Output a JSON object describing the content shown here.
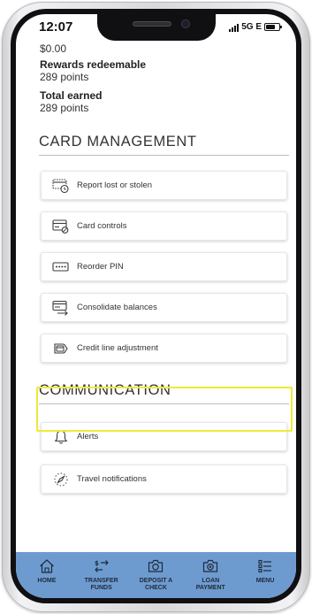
{
  "status_bar": {
    "time": "12:07",
    "network": "5G E"
  },
  "summary": {
    "balance": "$0.00",
    "rewards_label": "Rewards redeemable",
    "rewards_value": "289 points",
    "earned_label": "Total earned",
    "earned_value": "289 points"
  },
  "card_management": {
    "title": "CARD MANAGEMENT",
    "items": [
      {
        "label": "Report lost or stolen",
        "icon": "report-lost-card-icon"
      },
      {
        "label": "Card controls",
        "icon": "card-controls-icon"
      },
      {
        "label": "Reorder PIN",
        "icon": "pin-icon"
      },
      {
        "label": "Consolidate balances",
        "icon": "consolidate-icon"
      },
      {
        "label": "Credit line adjustment",
        "icon": "credit-line-icon"
      }
    ]
  },
  "communication": {
    "title": "COMMUNICATION",
    "items": [
      {
        "label": "Alerts",
        "icon": "bell-icon"
      },
      {
        "label": "Travel notifications",
        "icon": "compass-icon"
      }
    ]
  },
  "bottom_nav": {
    "items": [
      {
        "label": "HOME",
        "icon": "home-icon"
      },
      {
        "label": "TRANSFER\nFUNDS",
        "icon": "transfer-icon"
      },
      {
        "label": "DEPOSIT A\nCHECK",
        "icon": "camera-icon"
      },
      {
        "label": "LOAN\nPAYMENT",
        "icon": "loan-camera-icon"
      },
      {
        "label": "MENU",
        "icon": "menu-list-icon"
      }
    ]
  },
  "colors": {
    "nav_bg": "#6e9bcf",
    "highlight": "#eeea35",
    "icon": "#3a3a3a",
    "nav_icon": "#1d2a3a"
  }
}
